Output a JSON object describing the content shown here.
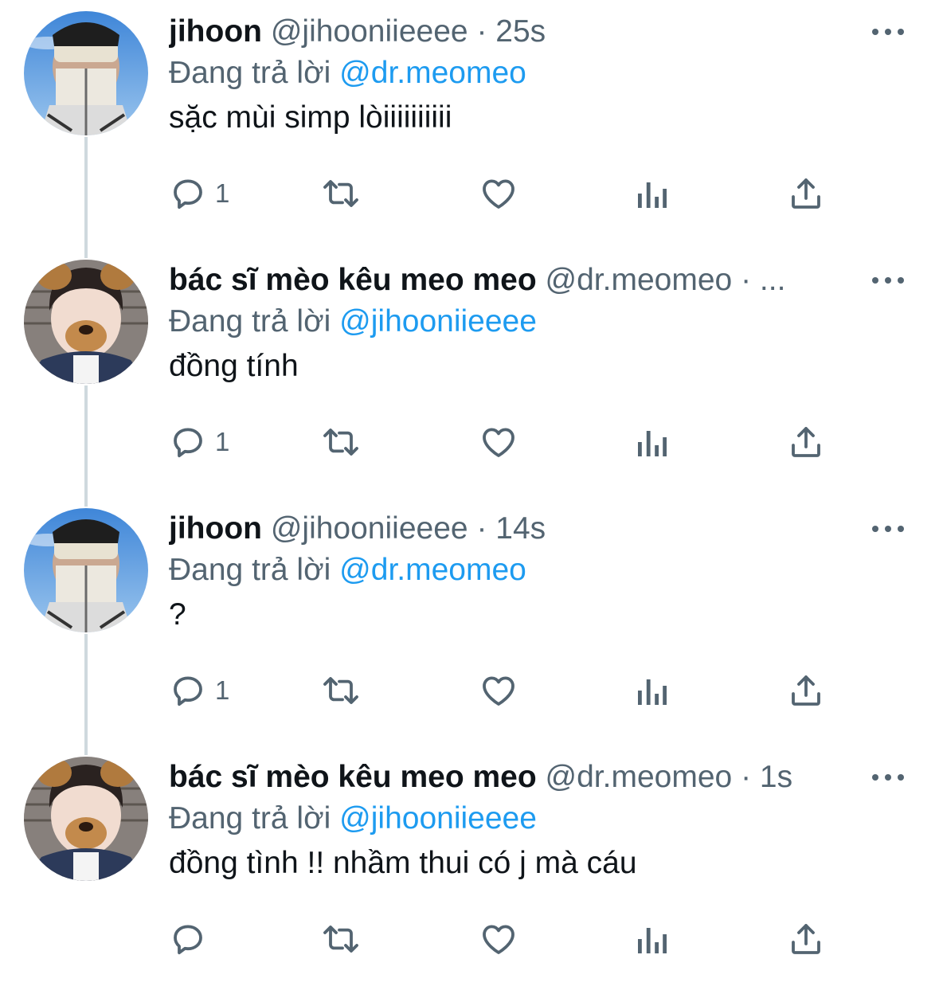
{
  "reply_prefix": "Đang trả lời",
  "icons": {
    "reply": "reply-icon",
    "retweet": "retweet-icon",
    "like": "heart-icon",
    "views": "analytics-icon",
    "share": "share-icon",
    "more": "more-icon"
  },
  "colors": {
    "text": "#0f1419",
    "secondary": "#536471",
    "link": "#1d9bf0",
    "thread_line": "#cfd9de"
  },
  "tweets": [
    {
      "name": "jihoon",
      "handle": "@jihooniieeee",
      "separator": "·",
      "time": "25s",
      "reply_to": "@dr.meomeo",
      "text": "sặc mùi simp lòiiiiiiiiii",
      "reply_count": "1"
    },
    {
      "name": "bác sĩ mèo kêu meo meo",
      "handle": "@dr.meomeo",
      "separator": "·",
      "time": "...",
      "reply_to": "@jihooniieeee",
      "text": "đồng tính",
      "reply_count": "1"
    },
    {
      "name": "jihoon",
      "handle": "@jihooniieeee",
      "separator": "·",
      "time": "14s",
      "reply_to": "@dr.meomeo",
      "text": "?",
      "reply_count": "1"
    },
    {
      "name": "bác sĩ mèo kêu meo meo",
      "handle": "@dr.meomeo",
      "separator": "·",
      "time": "1s",
      "reply_to": "@jihooniieeee",
      "text": "đồng tình !! nhầm thui có j mà cáu",
      "reply_count": ""
    }
  ]
}
